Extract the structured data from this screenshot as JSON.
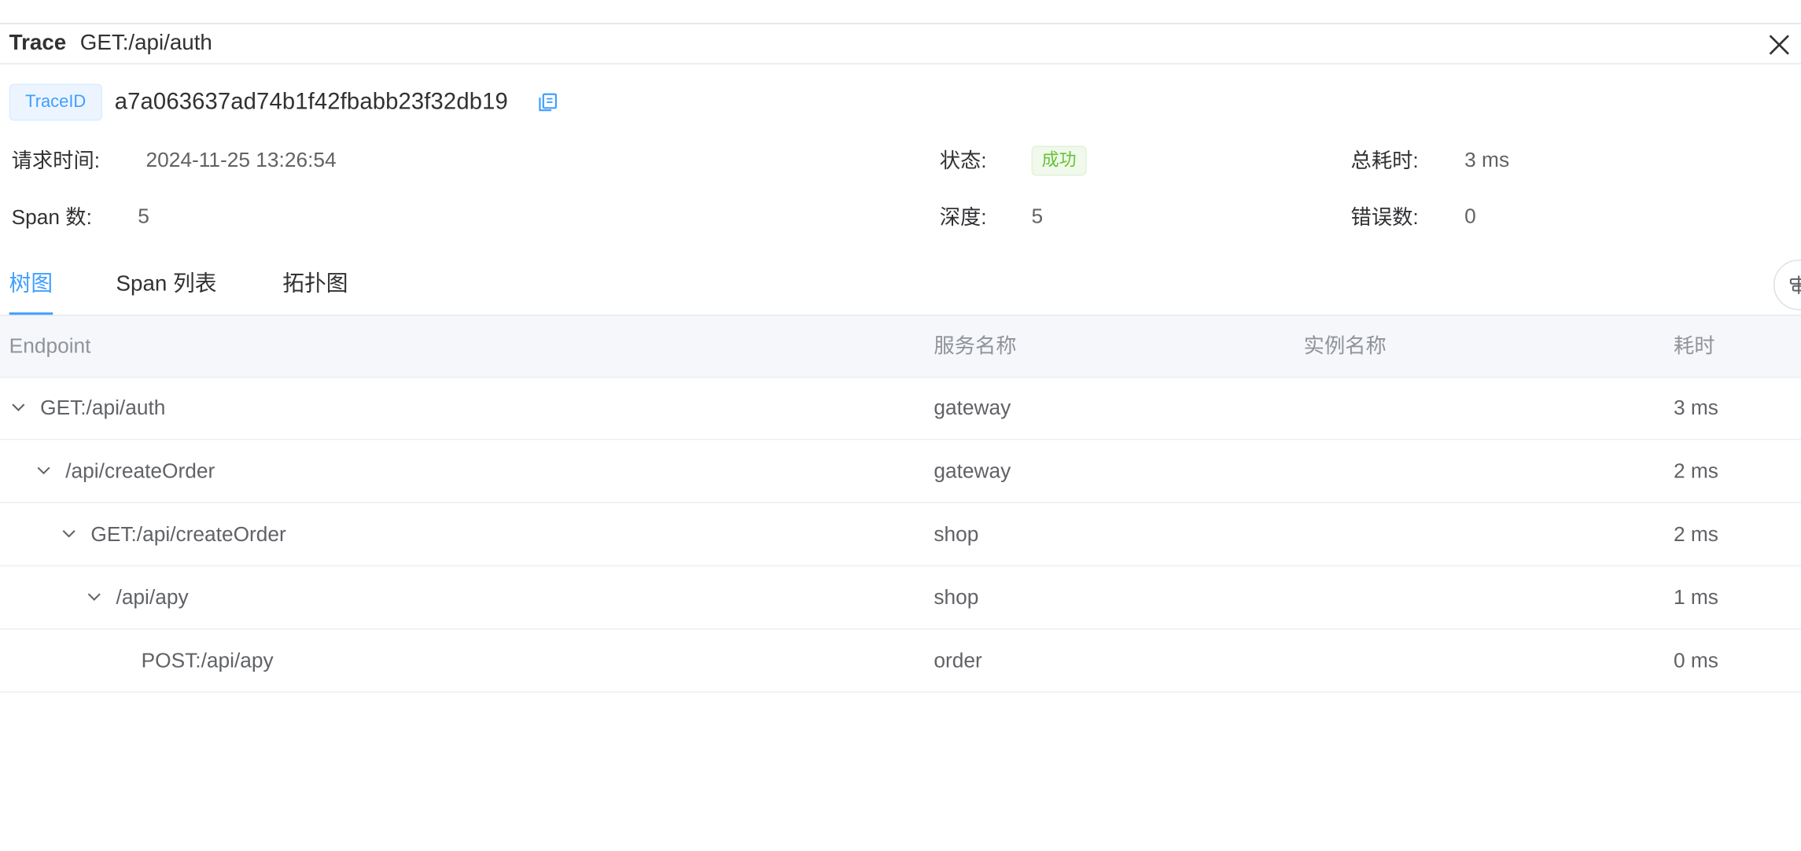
{
  "header": {
    "label": "Trace",
    "title": "GET:/api/auth"
  },
  "trace": {
    "id_label": "TraceID",
    "id": "a7a063637ad74b1f42fbabb23f32db19"
  },
  "meta": {
    "request_time_label": "请求时间:",
    "request_time": "2024-11-25 13:26:54",
    "status_label": "状态:",
    "status": "成功",
    "duration_label": "总耗时:",
    "duration": "3 ms",
    "span_count_label": "Span 数:",
    "span_count": "5",
    "depth_label": "深度:",
    "depth": "5",
    "error_count_label": "错误数:",
    "error_count": "0"
  },
  "tabs": [
    {
      "label": "树图",
      "active": true
    },
    {
      "label": "Span 列表",
      "active": false
    },
    {
      "label": "拓扑图",
      "active": false
    }
  ],
  "table": {
    "columns": [
      "Endpoint",
      "服务名称",
      "实例名称",
      "耗时"
    ],
    "rows": [
      {
        "endpoint": "GET:/api/auth",
        "service": "gateway",
        "instance": "",
        "duration": "3 ms",
        "level": 0,
        "expandable": true
      },
      {
        "endpoint": "/api/createOrder",
        "service": "gateway",
        "instance": "",
        "duration": "2 ms",
        "level": 1,
        "expandable": true
      },
      {
        "endpoint": "GET:/api/createOrder",
        "service": "shop",
        "instance": "",
        "duration": "2 ms",
        "level": 2,
        "expandable": true
      },
      {
        "endpoint": "/api/apy",
        "service": "shop",
        "instance": "",
        "duration": "1 ms",
        "level": 3,
        "expandable": true
      },
      {
        "endpoint": "POST:/api/apy",
        "service": "order",
        "instance": "",
        "duration": "0 ms",
        "level": 4,
        "expandable": false
      }
    ]
  },
  "colors": {
    "primary": "#409eff",
    "success": "#67c23a",
    "text": "#303133",
    "muted": "#909399"
  },
  "icons": {
    "close": "close-icon",
    "copy": "copy-icon",
    "align": "align-icon",
    "expand": "chevron-down-icon"
  }
}
